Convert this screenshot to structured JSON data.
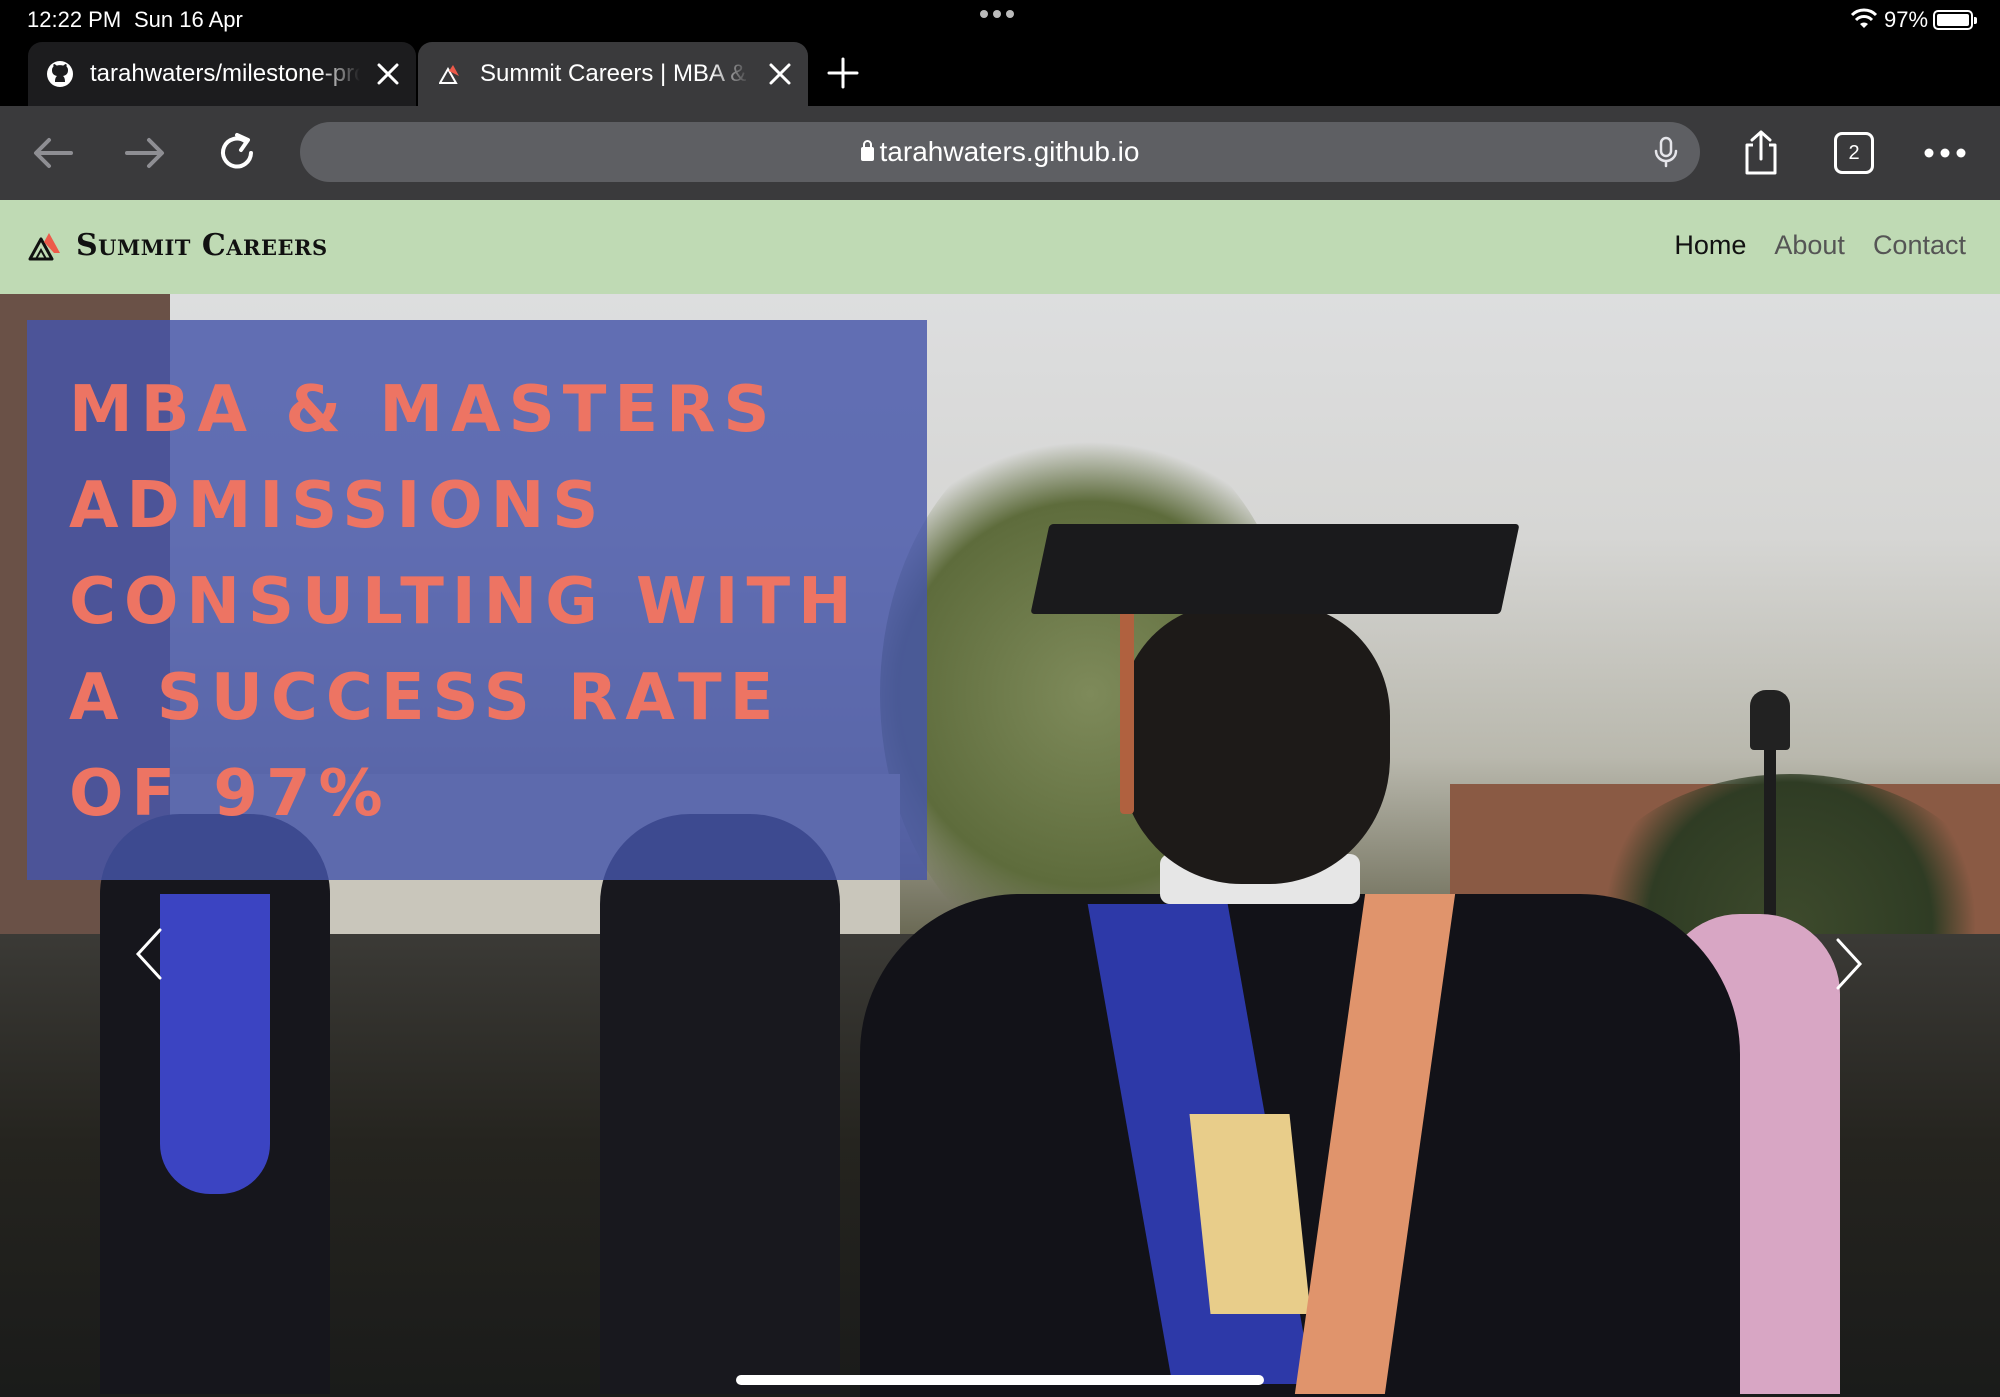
{
  "status_bar": {
    "time": "12:22 PM",
    "date": "Sun 16 Apr",
    "battery": "97%"
  },
  "tabs": [
    {
      "title": "tarahwaters/milestone-project",
      "icon": "github-icon"
    },
    {
      "title": "Summit Careers | MBA & Masters",
      "icon": "summit-logo-icon"
    }
  ],
  "toolbar": {
    "url": "tarahwaters.github.io",
    "tab_count": "2"
  },
  "site": {
    "brand": "Summit Careers",
    "nav": [
      {
        "label": "Home",
        "active": true
      },
      {
        "label": "About",
        "active": false
      },
      {
        "label": "Contact",
        "active": false
      }
    ],
    "hero_headline": "MBA & Masters Admissions Consulting with a success rate of 97%"
  },
  "colors": {
    "nav_background": "#bfdab4",
    "headline_box": "#4655aa",
    "headline_text": "#ed7463"
  }
}
